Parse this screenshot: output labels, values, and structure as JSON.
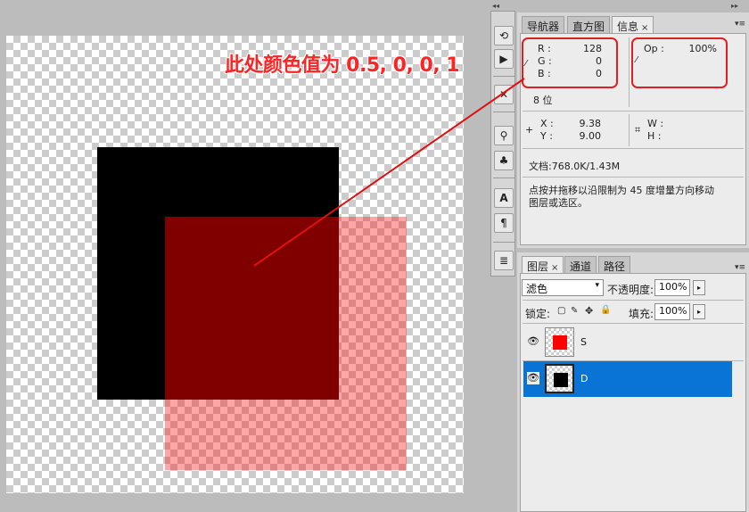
{
  "canvas": {
    "annotation": "此处颜色值为 0.5, 0, 0, 1",
    "layers_colors": {
      "d": "#000000",
      "s": "#ff0000",
      "overlap": "#800000"
    }
  },
  "tools": {
    "icons": [
      "history-icon",
      "actions-icon",
      "tools-icon",
      "brush-icon",
      "clone-source-icon",
      "character-icon",
      "paragraph-icon",
      "notes-icon"
    ]
  },
  "info_panel": {
    "tabs": [
      {
        "label": "导航器"
      },
      {
        "label": "直方图"
      },
      {
        "label": "信息"
      }
    ],
    "close": "×",
    "r_label": "R :",
    "r_value": "128",
    "g_label": "G :",
    "g_value": "0",
    "b_label": "B :",
    "b_value": "0",
    "op_label": "Op :",
    "op_value": "100%",
    "bit_depth": "8 位",
    "x_label": "X :",
    "x_value": "9.38",
    "y_label": "Y :",
    "y_value": "9.00",
    "w_label": "W :",
    "h_label": "H :",
    "doc": "文档:768.0K/1.43M",
    "hint_line1": "点按并拖移以沿限制为 45 度增量方向移动",
    "hint_line2": "图层或选区。"
  },
  "layers_panel": {
    "tabs": [
      {
        "label": "图层"
      },
      {
        "label": "通道"
      },
      {
        "label": "路径"
      }
    ],
    "close": "×",
    "blend_mode": "滤色",
    "opacity_label": "不透明度:",
    "opacity_value": "100%",
    "lock_label": "锁定:",
    "fill_label": "填充:",
    "fill_value": "100%",
    "layers": [
      {
        "name": "S",
        "color": "#ff0000",
        "selected": false
      },
      {
        "name": "D",
        "color": "#000000",
        "selected": true
      }
    ],
    "selected_color": "#0a74d6"
  }
}
